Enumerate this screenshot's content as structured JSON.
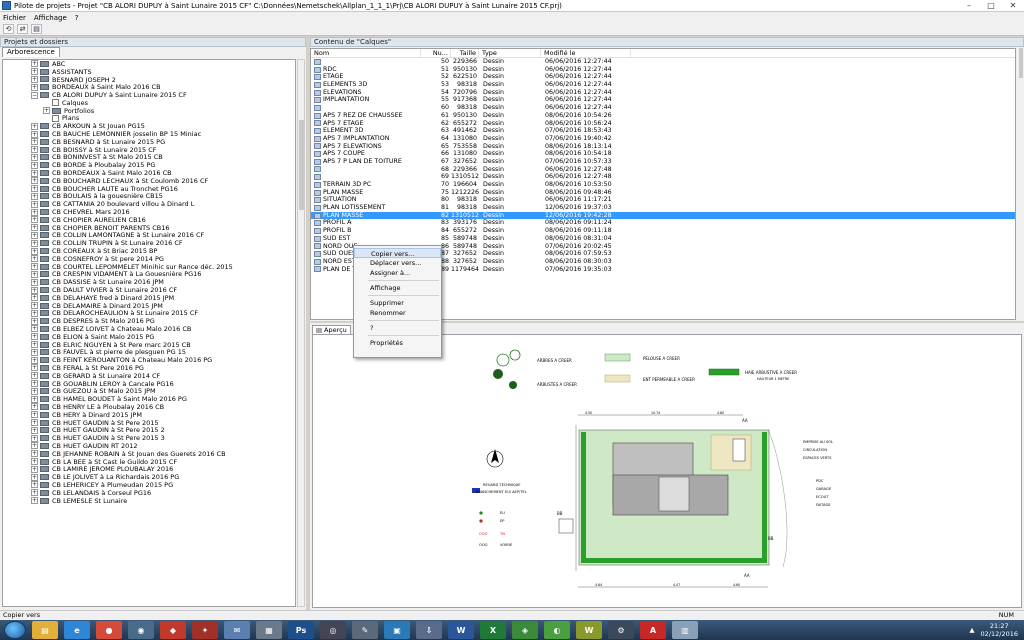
{
  "window": {
    "title": "Pilote de projets - Projet \"CB ALORI DUPUY à Saint Lunaire 2015 CF\" C:\\Données\\Nemetschek\\Allplan_1_1_1\\Prj\\CB ALORI DUPUY à Saint Lunaire 2015 CF.prj)",
    "minimize": "–",
    "maximize": "□",
    "close": "✕"
  },
  "menu": [
    "Fichier",
    "Affichage",
    "?"
  ],
  "left": {
    "header": "Projets et dossiers",
    "tab": "Arborescence",
    "tree": [
      {
        "label": "ABC",
        "exp": "+",
        "indent": 1
      },
      {
        "label": "ASSISTANTS",
        "exp": "+",
        "indent": 1
      },
      {
        "label": "BESNARD JOSEPH 2",
        "exp": "+",
        "indent": 1
      },
      {
        "label": "BORDEAUX à Saint Malo 2016 CB",
        "exp": "+",
        "indent": 1
      },
      {
        "label": "CB ALORI DUPUY à Saint Lunaire 2015 CF",
        "exp": "−",
        "indent": 1
      },
      {
        "label": "Calques",
        "exp": "",
        "indent": 2,
        "doc": true
      },
      {
        "label": "Portfolios",
        "exp": "+",
        "indent": 2
      },
      {
        "label": "Plans",
        "exp": "",
        "indent": 2,
        "doc": true
      },
      {
        "label": "CB ARKOUN à St Jouan PG15",
        "exp": "+",
        "indent": 1
      },
      {
        "label": "CB BAUCHE LEMONNIER josselin BP 15 Miniac",
        "exp": "+",
        "indent": 1
      },
      {
        "label": "CB BESNARD à St Lunaire 2015 PG",
        "exp": "+",
        "indent": 1
      },
      {
        "label": "CB BOISSY à St Lunaire 2015 CF",
        "exp": "+",
        "indent": 1
      },
      {
        "label": "CB BONINVEST à St Malo 2015 CB",
        "exp": "+",
        "indent": 1
      },
      {
        "label": "CB BORDE à Ploubalay 2015 PG",
        "exp": "+",
        "indent": 1
      },
      {
        "label": "CB BORDEAUX à Saint Malo 2016 CB",
        "exp": "+",
        "indent": 1
      },
      {
        "label": "CB BOUCHARD LECHAUX à St Coulomb 2016 CF",
        "exp": "+",
        "indent": 1
      },
      {
        "label": "CB BOUCHER LAUTE au Tronchet PG16",
        "exp": "+",
        "indent": 1
      },
      {
        "label": "CB BOULAIS à la gouesnière CB15",
        "exp": "+",
        "indent": 1
      },
      {
        "label": "CB CATTANIA 20 boulevard villou à Dinard L",
        "exp": "+",
        "indent": 1
      },
      {
        "label": "CB CHEVREL Mars 2016",
        "exp": "+",
        "indent": 1
      },
      {
        "label": "CB CHOPIER AURELIEN CB16",
        "exp": "+",
        "indent": 1
      },
      {
        "label": "CB CHOPIER BENOIT PARENTS CB16",
        "exp": "+",
        "indent": 1
      },
      {
        "label": "CB COLLIN LAMONTAGNE à St Lunaire 2016 CF",
        "exp": "+",
        "indent": 1
      },
      {
        "label": "CB COLLIN TRUPIN à St Lunaire 2016 CF",
        "exp": "+",
        "indent": 1
      },
      {
        "label": "CB COREAUX à St Briac 2015 BP",
        "exp": "+",
        "indent": 1
      },
      {
        "label": "CB COSNEFROY à St pere 2014 PG",
        "exp": "+",
        "indent": 1
      },
      {
        "label": "CB COURTEL LEPOMMELET Minihic sur Rance déc. 2015",
        "exp": "+",
        "indent": 1
      },
      {
        "label": "CB CRESPIN VIDAMENT à La Gouesnière PG16",
        "exp": "+",
        "indent": 1
      },
      {
        "label": "CB DASSISE à St Lunaire 2016 JPM",
        "exp": "+",
        "indent": 1
      },
      {
        "label": "CB DAULT VIVIER à St Lunaire 2016 CF",
        "exp": "+",
        "indent": 1
      },
      {
        "label": "CB DELAHAYE fred à Dinard 2015 JPM",
        "exp": "+",
        "indent": 1
      },
      {
        "label": "CB DELAMAIRE à Dinard 2015 JPM",
        "exp": "+",
        "indent": 1
      },
      {
        "label": "CB DELAROCHEAULION à St Lunaire 2015 CF",
        "exp": "+",
        "indent": 1
      },
      {
        "label": "CB DESPRES à St Malo 2016 PG",
        "exp": "+",
        "indent": 1
      },
      {
        "label": "CB ELBEZ LOIVET à Chateau Malo 2016 CB",
        "exp": "+",
        "indent": 1
      },
      {
        "label": "CB ELION à Saint Malo 2015 PG",
        "exp": "+",
        "indent": 1
      },
      {
        "label": "CB ELRIC NGUYEN à St Pere marc 2015 CB",
        "exp": "+",
        "indent": 1
      },
      {
        "label": "CB FAUVEL à st pierre de plesguen PG 15",
        "exp": "+",
        "indent": 1
      },
      {
        "label": "CB FEINT KEROUANTON à Chateau Malo 2016 PG",
        "exp": "+",
        "indent": 1
      },
      {
        "label": "CB FERAL à St Pere 2016 PG",
        "exp": "+",
        "indent": 1
      },
      {
        "label": "CB GERARD à St Lunaire 2014 CF",
        "exp": "+",
        "indent": 1
      },
      {
        "label": "CB GOUABLIN LEROY à Cancale PG16",
        "exp": "+",
        "indent": 1
      },
      {
        "label": "CB GUEZOU à St Malo 2015 JPM",
        "exp": "+",
        "indent": 1
      },
      {
        "label": "CB HAMEL BOUDET à Saint Malo 2016 PG",
        "exp": "+",
        "indent": 1
      },
      {
        "label": "CB HENRY LE à Ploubalay 2016 CB",
        "exp": "+",
        "indent": 1
      },
      {
        "label": "CB HERY à Dinard 2015 JPM",
        "exp": "+",
        "indent": 1
      },
      {
        "label": "CB HUET GAUDIN à St Pere 2015",
        "exp": "+",
        "indent": 1
      },
      {
        "label": "CB HUET GAUDIN à St Pere 2015 2",
        "exp": "+",
        "indent": 1
      },
      {
        "label": "CB HUET GAUDIN à St Pere 2015 3",
        "exp": "+",
        "indent": 1
      },
      {
        "label": "CB HUET GAUDIN RT 2012",
        "exp": "+",
        "indent": 1
      },
      {
        "label": "CB JEHANNE ROBAIN à St Jouan des Guerets 2016 CB",
        "exp": "+",
        "indent": 1
      },
      {
        "label": "CB LA BEE à St Cast le Guildo 2015 CF",
        "exp": "+",
        "indent": 1
      },
      {
        "label": "CB LAMIRE JEROME PLOUBALAY 2016",
        "exp": "+",
        "indent": 1
      },
      {
        "label": "CB LE JOLIVET à La Richardais 2016 PG",
        "exp": "+",
        "indent": 1
      },
      {
        "label": "CB LEHERICEY à Plumeudan 2015 PG",
        "exp": "+",
        "indent": 1
      },
      {
        "label": "CB LELANDAIS à Corseul PG16",
        "exp": "+",
        "indent": 1
      },
      {
        "label": "CB LEMESLE St Lunaire",
        "exp": "+",
        "indent": 1
      }
    ]
  },
  "right": {
    "header": "Contenu de \"Calques\"",
    "columns": [
      "Nom",
      "Nu...",
      "Taille",
      "Type",
      "Modifié le"
    ],
    "rows": [
      {
        "name": "",
        "num": "50",
        "size": "229366",
        "type": "Dessin",
        "mod": "06/06/2016 12:27:44"
      },
      {
        "name": "RDC",
        "num": "51",
        "size": "950130",
        "type": "Dessin",
        "mod": "06/06/2016 12:27:44"
      },
      {
        "name": "ETAGE",
        "num": "52",
        "size": "622510",
        "type": "Dessin",
        "mod": "06/06/2016 12:27:44"
      },
      {
        "name": "ELEMENTS 3D",
        "num": "53",
        "size": "98318",
        "type": "Dessin",
        "mod": "06/06/2016 12:27:44"
      },
      {
        "name": "ELEVATIONS",
        "num": "54",
        "size": "720796",
        "type": "Dessin",
        "mod": "06/06/2016 12:27:44"
      },
      {
        "name": "IMPLANTATION",
        "num": "55",
        "size": "917368",
        "type": "Dessin",
        "mod": "06/06/2016 12:27:44"
      },
      {
        "name": "",
        "num": "60",
        "size": "98318",
        "type": "Dessin",
        "mod": "06/06/2016 12:27:44"
      },
      {
        "name": "APS 7 REZ DE CHAUSSEE",
        "num": "61",
        "size": "950130",
        "type": "Dessin",
        "mod": "08/06/2016 10:54:26"
      },
      {
        "name": "APS 7 ETAGE",
        "num": "62",
        "size": "655272",
        "type": "Dessin",
        "mod": "08/06/2016 10:56:24"
      },
      {
        "name": "ELEMENT 3D",
        "num": "63",
        "size": "491462",
        "type": "Dessin",
        "mod": "07/06/2016 18:53:43"
      },
      {
        "name": "APS 7 IMPLANTATION",
        "num": "64",
        "size": "131080",
        "type": "Dessin",
        "mod": "07/06/2016 19:40:42"
      },
      {
        "name": "APS 7 ELEVATIONS",
        "num": "65",
        "size": "753558",
        "type": "Dessin",
        "mod": "08/06/2016 18:13:14"
      },
      {
        "name": "APS 7 COUPE",
        "num": "66",
        "size": "131080",
        "type": "Dessin",
        "mod": "08/06/2016 10:54:18"
      },
      {
        "name": "APS 7 P LAN DE TOITURE",
        "num": "67",
        "size": "327652",
        "type": "Dessin",
        "mod": "07/06/2016 10:57:33"
      },
      {
        "name": "",
        "num": "68",
        "size": "229366",
        "type": "Dessin",
        "mod": "06/06/2016 12:27:48"
      },
      {
        "name": "",
        "num": "69",
        "size": "1310512",
        "type": "Dessin",
        "mod": "06/06/2016 12:27:48"
      },
      {
        "name": "TERRAIN 3D PC",
        "num": "70",
        "size": "196604",
        "type": "Dessin",
        "mod": "08/06/2016 10:53:50"
      },
      {
        "name": "PLAN MASSE",
        "num": "75",
        "size": "1212226",
        "type": "Dessin",
        "mod": "08/06/2016 09:48:46"
      },
      {
        "name": "SITUATION",
        "num": "80",
        "size": "98318",
        "type": "Dessin",
        "mod": "06/06/2016 11:17:21"
      },
      {
        "name": "PLAN LOTISSEMENT",
        "num": "81",
        "size": "98318",
        "type": "Dessin",
        "mod": "12/06/2016 19:37:03"
      },
      {
        "name": "PLAN MASSE",
        "num": "82",
        "size": "1310512",
        "type": "Dessin",
        "mod": "12/06/2016 19:42:28",
        "selected": true
      },
      {
        "name": "PROFIL A",
        "num": "83",
        "size": "393176",
        "type": "Dessin",
        "mod": "08/06/2016 09:11:24"
      },
      {
        "name": "PROFIL B",
        "num": "84",
        "size": "655272",
        "type": "Dessin",
        "mod": "08/06/2016 09:11:18"
      },
      {
        "name": "SUD EST",
        "num": "85",
        "size": "589748",
        "type": "Dessin",
        "mod": "08/06/2016 08:31:04"
      },
      {
        "name": "NORD OUE",
        "num": "86",
        "size": "589748",
        "type": "Dessin",
        "mod": "07/06/2016 20:02:45"
      },
      {
        "name": "SUD OUES",
        "num": "87",
        "size": "327652",
        "type": "Dessin",
        "mod": "08/06/2016 07:59:53"
      },
      {
        "name": "NORD EST",
        "num": "88",
        "size": "327652",
        "type": "Dessin",
        "mod": "08/06/2016 08:30:03"
      },
      {
        "name": "PLAN DE T",
        "num": "89",
        "size": "1179464",
        "type": "Dessin",
        "mod": "07/06/2016 19:35:03"
      }
    ]
  },
  "context_menu": {
    "items": [
      "Copier vers...",
      "Déplacer vers...",
      "Assigner à...",
      "Affichage",
      "Supprimer",
      "Renommer",
      "?",
      "Propriétés"
    ]
  },
  "preview": {
    "tab": "Aperçu",
    "legend": {
      "arbres": "ARBRES A CREER",
      "arbustes": "ARBUSTES A CREER",
      "pelouse": "PELOUSE A CREER",
      "enrobe": "ENT PERMEABLE A CREER",
      "haie": "HAIE ARBUSTIVE A CREER",
      "haie_sub": "HAUTEUR 1 METRE",
      "regard": "REGARD TECHNIQUE",
      "branchement": "BRANCHEMENT EU/ AEP/TEL",
      "eu": "EU",
      "ep": "EP",
      "tn": "TN",
      "voirie": "VOIRIE",
      "ooo": "OOO"
    },
    "stats": {
      "emprise": "EMPRISE AU SOL",
      "circulation": "CIRCULATION",
      "espaces": "ESPACES VERTS",
      "pdc": "PDC",
      "garage": "GARAGE",
      "ecout": "ECOUT",
      "faitage": "FAITAGE"
    },
    "dims": {
      "d1": "4.50",
      "d2": "10.74",
      "d3": "4.80",
      "d4": "4.64",
      "d5": "4.47",
      "d6": "4.60"
    },
    "section_aa": "AA",
    "section_bb": "BB"
  },
  "status": {
    "left": "Copier vers",
    "right": "NUM"
  },
  "taskbar": {
    "time": "21:27",
    "date": "02/12/2016",
    "apps": [
      {
        "icon": "explorer-icon",
        "color": "#e2b03a",
        "glyph": "▤"
      },
      {
        "icon": "ie-icon",
        "color": "#2f86d6",
        "glyph": "e"
      },
      {
        "icon": "chrome-icon",
        "color": "#d64a3a",
        "glyph": "●"
      },
      {
        "icon": "steam-icon",
        "color": "#4a6a8a",
        "glyph": "◉"
      },
      {
        "icon": "red-app-icon",
        "color": "#c0392b",
        "glyph": "◆"
      },
      {
        "icon": "pdf-app-icon",
        "color": "#a03028",
        "glyph": "✦"
      },
      {
        "icon": "mail-icon",
        "color": "#5a7fb0",
        "glyph": "✉"
      },
      {
        "icon": "files-icon",
        "color": "#6a7a8a",
        "glyph": "▦"
      },
      {
        "icon": "photoshop-icon",
        "color": "#1f4f8a",
        "glyph": "Ps"
      },
      {
        "icon": "circle-app-icon",
        "color": "#445",
        "glyph": "◎"
      },
      {
        "icon": "pen-app-icon",
        "color": "#5a6a7a",
        "glyph": "✎"
      },
      {
        "icon": "photos-icon",
        "color": "#2a7ab8",
        "glyph": "▣"
      },
      {
        "icon": "download-icon",
        "color": "#5a6a8a",
        "glyph": "⇩"
      },
      {
        "icon": "word-icon",
        "color": "#2b579a",
        "glyph": "W"
      },
      {
        "icon": "excel-icon",
        "color": "#1f7a3a",
        "glyph": "X"
      },
      {
        "icon": "map-app-icon",
        "color": "#3a8a3a",
        "glyph": "◈"
      },
      {
        "icon": "green-app-icon",
        "color": "#4aa040",
        "glyph": "◐"
      },
      {
        "icon": "w-app-icon",
        "color": "#8a9a2a",
        "glyph": "W"
      },
      {
        "icon": "tools-icon",
        "color": "#3a4a5a",
        "glyph": "⚙"
      },
      {
        "icon": "acrobat-icon",
        "color": "#c62828",
        "glyph": "A"
      },
      {
        "icon": "allplan-icon",
        "color": "#8aa0b8",
        "glyph": "▥"
      }
    ]
  }
}
